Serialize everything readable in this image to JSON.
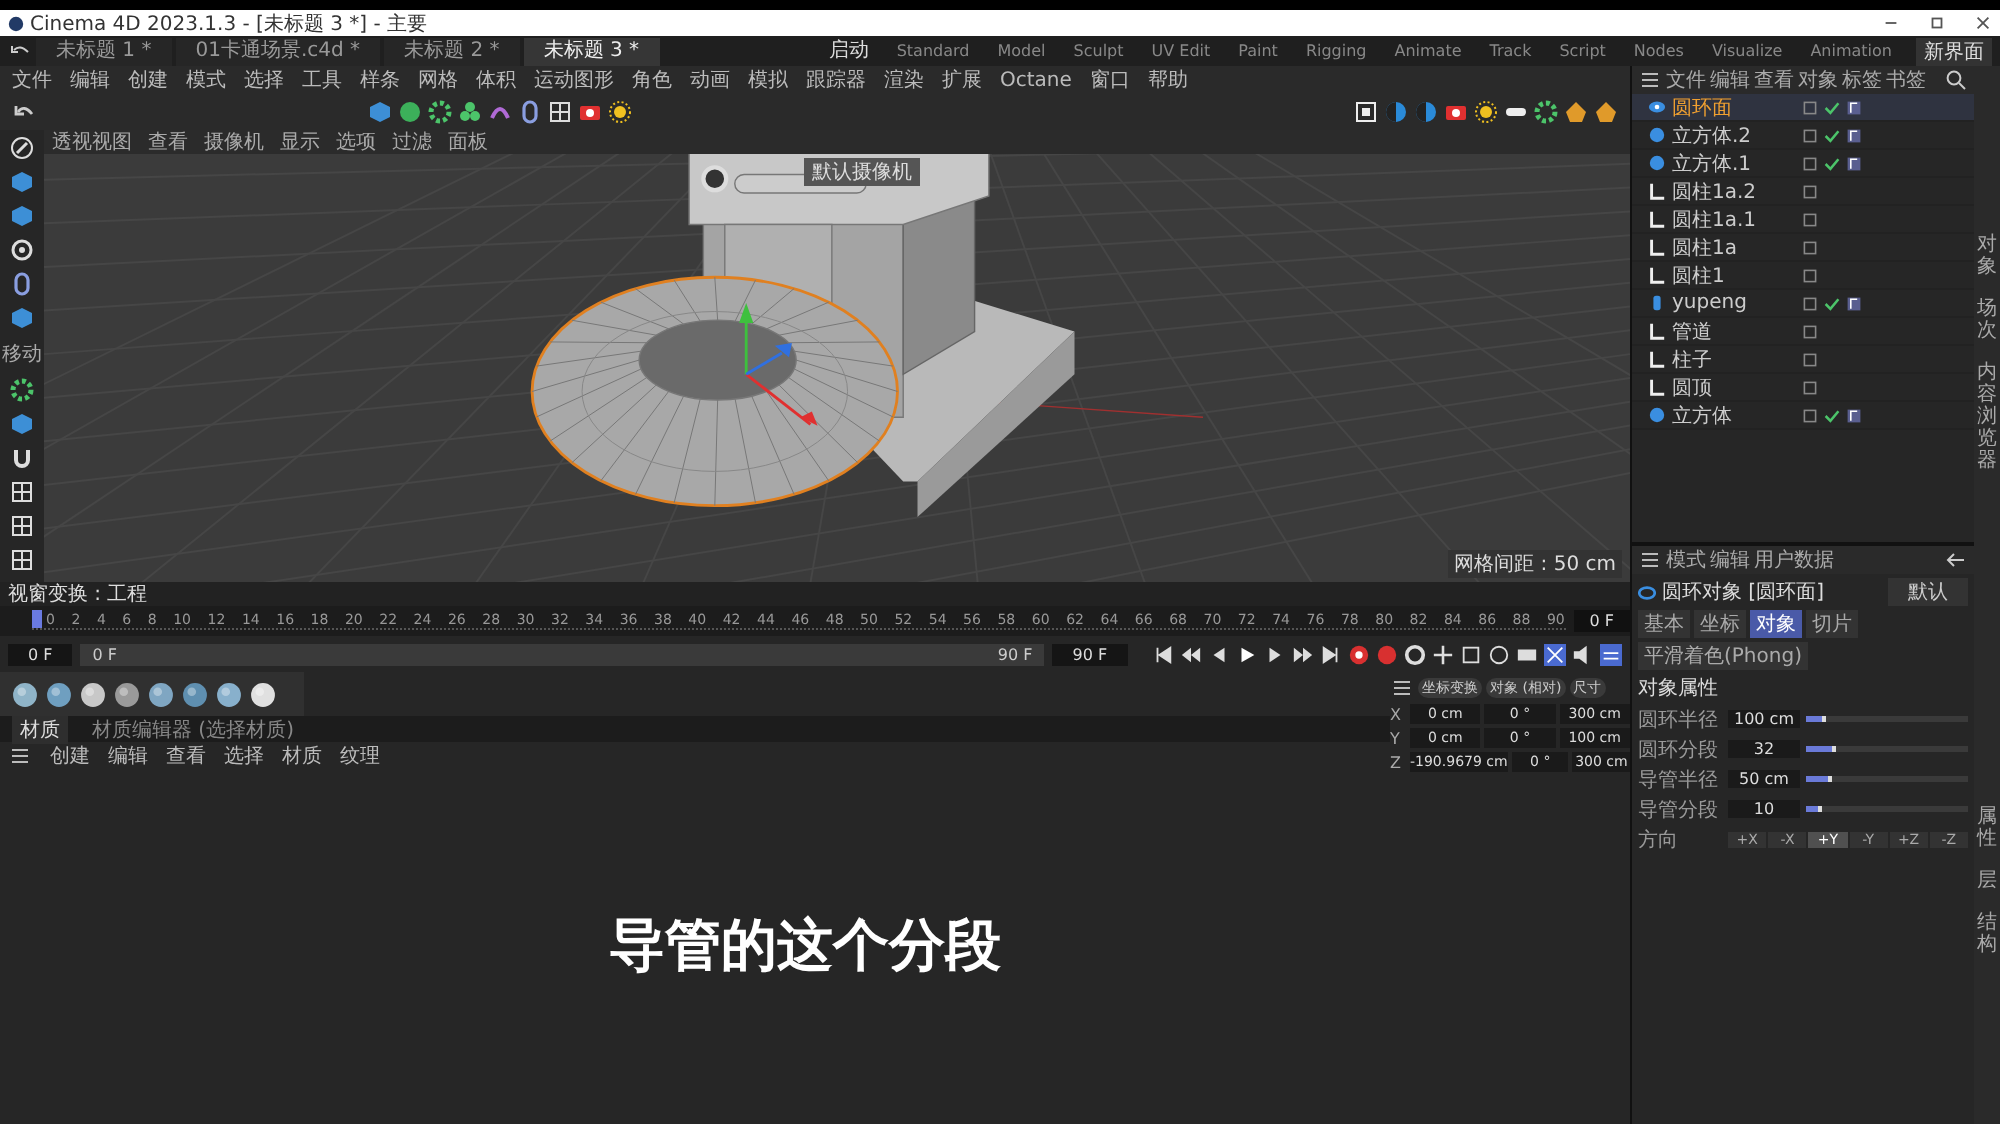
{
  "window": {
    "title": "Cinema 4D 2023.1.3 - [未标题 3 *] - 主要"
  },
  "document_tabs": [
    {
      "label": "未标题 1 *",
      "selected": false
    },
    {
      "label": "01卡通场景.c4d *",
      "selected": false
    },
    {
      "label": "未标题 2 *",
      "selected": false
    },
    {
      "label": "未标题 3 *",
      "selected": true
    }
  ],
  "layout_tabs": [
    {
      "label": "启动",
      "selected": true
    },
    {
      "label": "Standard",
      "selected": false
    },
    {
      "label": "Model",
      "selected": false
    },
    {
      "label": "Sculpt",
      "selected": false
    },
    {
      "label": "UV Edit",
      "selected": false
    },
    {
      "label": "Paint",
      "selected": false
    },
    {
      "label": "Rigging",
      "selected": false
    },
    {
      "label": "Animate",
      "selected": false
    },
    {
      "label": "Track",
      "selected": false
    },
    {
      "label": "Script",
      "selected": false
    },
    {
      "label": "Nodes",
      "selected": false
    },
    {
      "label": "Visualize",
      "selected": false
    },
    {
      "label": "Animation",
      "selected": false
    }
  ],
  "new_layout_button": "新界面",
  "main_menu": [
    "文件",
    "编辑",
    "创建",
    "模式",
    "选择",
    "工具",
    "样条",
    "网格",
    "体积",
    "运动图形",
    "角色",
    "动画",
    "模拟",
    "跟踪器",
    "渲染",
    "扩展",
    "Octane",
    "窗口",
    "帮助"
  ],
  "left_tools_label": "移动",
  "viewport": {
    "title": "透视视图",
    "menu": [
      "查看",
      "摄像机",
      "显示",
      "选项",
      "过滤",
      "面板"
    ],
    "camera_label": "默认摄像机",
    "grid_label": "网格间距 : 50 cm"
  },
  "object_manager": {
    "menu": [
      "文件",
      "编辑",
      "查看",
      "对象",
      "标签",
      "书签"
    ],
    "objects": [
      {
        "name": "圆环面",
        "kind": "torus",
        "selected": true,
        "checked": true,
        "has_tag": true
      },
      {
        "name": "立方体.2",
        "kind": "cube",
        "selected": false,
        "checked": true,
        "has_tag": true
      },
      {
        "name": "立方体.1",
        "kind": "cube",
        "selected": false,
        "checked": true,
        "has_tag": true
      },
      {
        "name": "圆柱1a.2",
        "kind": "group",
        "selected": false,
        "checked": false,
        "has_tag": false
      },
      {
        "name": "圆柱1a.1",
        "kind": "group",
        "selected": false,
        "checked": false,
        "has_tag": false
      },
      {
        "name": "圆柱1a",
        "kind": "group",
        "selected": false,
        "checked": false,
        "has_tag": false
      },
      {
        "name": "圆柱1",
        "kind": "group",
        "selected": false,
        "checked": false,
        "has_tag": false
      },
      {
        "name": "yupeng",
        "kind": "cylinder",
        "selected": false,
        "checked": true,
        "has_tag": true
      },
      {
        "name": "管道",
        "kind": "group",
        "selected": false,
        "checked": false,
        "has_tag": false
      },
      {
        "name": "柱子",
        "kind": "group",
        "selected": false,
        "checked": false,
        "has_tag": false
      },
      {
        "name": "圆顶",
        "kind": "group",
        "selected": false,
        "checked": false,
        "has_tag": false
      },
      {
        "name": "立方体",
        "kind": "cube",
        "selected": false,
        "checked": true,
        "has_tag": true
      }
    ]
  },
  "side_tabs": [
    "对象",
    "场次",
    "内容浏览器"
  ],
  "attribute_side_tabs": [
    "属性",
    "层",
    "结构"
  ],
  "attribute_manager": {
    "menu": [
      "模式",
      "编辑",
      "用户数据"
    ],
    "object_title": "圆环对象 [圆环面]",
    "preset": "默认",
    "tabs": [
      {
        "label": "基本",
        "selected": false
      },
      {
        "label": "坐标",
        "selected": false
      },
      {
        "label": "对象",
        "selected": true
      },
      {
        "label": "切片",
        "selected": false
      },
      {
        "label": "平滑着色(Phong)",
        "selected": false
      }
    ],
    "section": "对象属性",
    "fields": [
      {
        "label": "圆环半径",
        "value": "100 cm",
        "level": 0.1
      },
      {
        "label": "圆环分段",
        "value": "32",
        "level": 0.16
      },
      {
        "label": "导管半径",
        "value": "50 cm",
        "level": 0.13
      },
      {
        "label": "导管分段",
        "value": "10",
        "level": 0.07
      }
    ],
    "direction": {
      "label": "方向",
      "options": [
        {
          "label": "+X",
          "selected": false
        },
        {
          "label": "-X",
          "selected": false
        },
        {
          "label": "+Y",
          "selected": true
        },
        {
          "label": "-Y",
          "selected": false
        },
        {
          "label": "+Z",
          "selected": false
        },
        {
          "label": "-Z",
          "selected": false
        }
      ]
    }
  },
  "timeline": {
    "header": "视窗变换 : 工程",
    "ticks": [
      "0",
      "2",
      "4",
      "6",
      "8",
      "10",
      "12",
      "14",
      "16",
      "18",
      "20",
      "22",
      "24",
      "26",
      "28",
      "30",
      "32",
      "34",
      "36",
      "38",
      "40",
      "42",
      "44",
      "46",
      "48",
      "50",
      "52",
      "54",
      "56",
      "58",
      "60",
      "62",
      "64",
      "66",
      "68",
      "70",
      "72",
      "74",
      "76",
      "78",
      "80",
      "82",
      "84",
      "86",
      "88",
      "90"
    ],
    "level": 0,
    "current_frame": "0 F",
    "start_field": "0 F",
    "range_start": "0 F",
    "range_end": "90 F",
    "end_field": "90 F"
  },
  "materials": {
    "tabs": [
      {
        "label": "材质",
        "selected": true
      },
      {
        "label": "材质编辑器 (选择材质)",
        "selected": false
      }
    ],
    "menu": [
      "创建",
      "编辑",
      "查看",
      "选择",
      "材质",
      "纹理"
    ]
  },
  "coordinates": {
    "headers": [
      "坐标变换",
      "对象 (相对)",
      "尺寸"
    ],
    "rows": [
      {
        "axis": "X",
        "position": "0 cm",
        "rotation": "0 °",
        "size": "300 cm"
      },
      {
        "axis": "Y",
        "position": "0 cm",
        "rotation": "0 °",
        "size": "100 cm"
      },
      {
        "axis": "Z",
        "position": "-190.9679 cm",
        "rotation": "0 °",
        "size": "300 cm"
      }
    ]
  },
  "subtitle": "导管的这个分段"
}
